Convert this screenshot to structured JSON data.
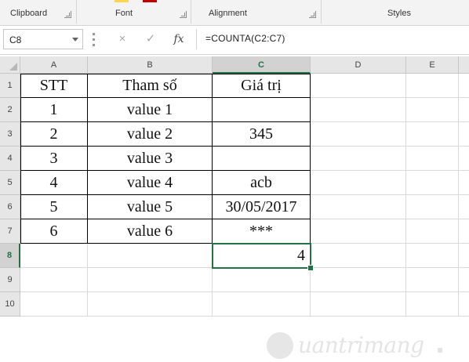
{
  "ribbon": {
    "groups": [
      {
        "label": "Clipboard",
        "has_launcher": true
      },
      {
        "label": "Font",
        "has_launcher": true
      },
      {
        "label": "Alignment",
        "has_launcher": true
      },
      {
        "label": "Styles",
        "has_launcher": false
      }
    ],
    "accent_colors": {
      "highlight": "#ffd54f",
      "font_color": "#c00000",
      "ribbon_bg": "#f3f3f3",
      "selection": "#217346"
    }
  },
  "formula_bar": {
    "name_box": "C8",
    "cancel_icon": "×",
    "enter_icon": "✓",
    "fx_label": "fx",
    "formula": "=COUNTA(C2:C7)"
  },
  "grid": {
    "column_headers": [
      "A",
      "B",
      "C",
      "D",
      "E"
    ],
    "active_column": "C",
    "row_headers": [
      "1",
      "2",
      "3",
      "4",
      "5",
      "6",
      "7",
      "8",
      "9",
      "10"
    ],
    "active_row": "8",
    "rows": [
      [
        "STT",
        "Tham số",
        "Giá trị"
      ],
      [
        "1",
        "value 1",
        ""
      ],
      [
        "2",
        "value 2",
        "345"
      ],
      [
        "3",
        "value 3",
        ""
      ],
      [
        "4",
        "value 4",
        "acb"
      ],
      [
        "5",
        "value 5",
        "30/05/2017"
      ],
      [
        "6",
        "value 6",
        "***"
      ],
      [
        "",
        "",
        "4"
      ],
      [
        "",
        "",
        ""
      ],
      [
        "",
        "",
        ""
      ]
    ],
    "selected_cell": "C8"
  },
  "watermark": {
    "text": "uantrimang"
  }
}
